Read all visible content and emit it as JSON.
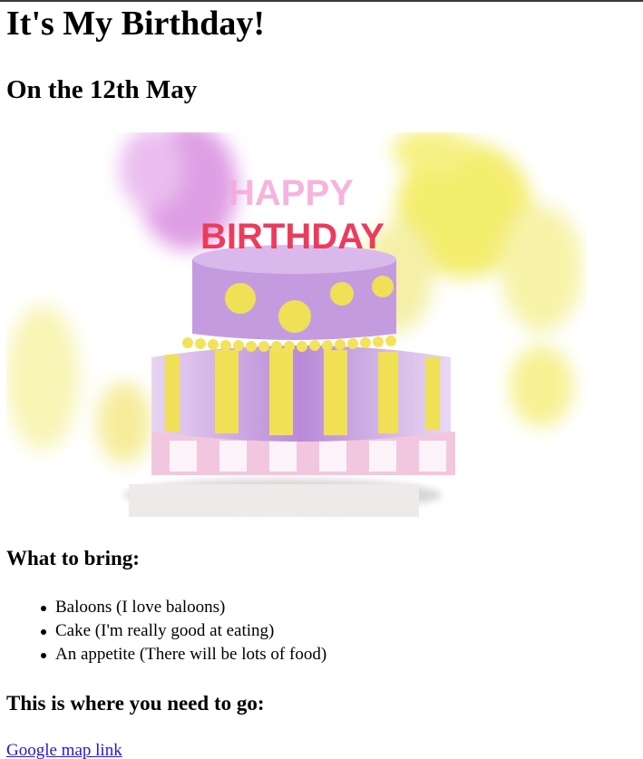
{
  "page": {
    "title": "It's My Birthday!",
    "subtitle": "On the 12th May",
    "image": {
      "alt": "Birthday cake",
      "cake_text_top": "HAPPY",
      "cake_text_bottom": "BIRTHDAY"
    },
    "bring_heading": "What to bring:",
    "bring_items": [
      "Baloons (I love baloons)",
      "Cake (I'm really good at eating)",
      "An appetite (There will be lots of food)"
    ],
    "directions_heading": "This is where you need to go:",
    "map_link": "Google map link"
  },
  "colors": {
    "link": "#2a14d8",
    "balloon_pink": "#d98ee0",
    "balloon_yellow": "#f2ea55",
    "cake_purple": "#c59be0",
    "cake_yellow": "#efe056"
  }
}
